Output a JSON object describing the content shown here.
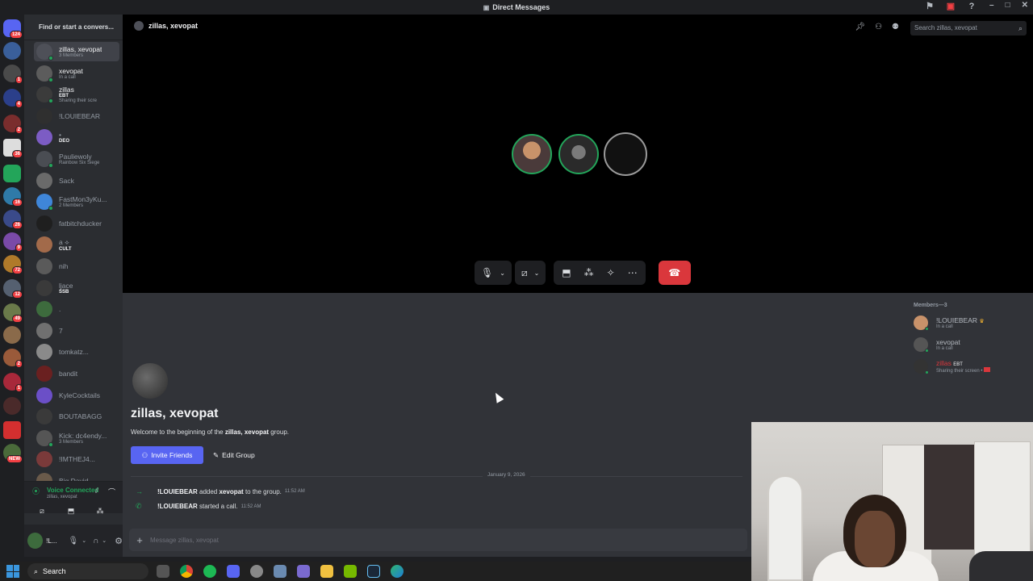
{
  "window": {
    "title": "Direct Messages",
    "controls": [
      "–",
      "□",
      "✕"
    ]
  },
  "dm_sidebar": {
    "find_placeholder": "Find or start a convers...",
    "items": [
      {
        "name": "zillas, xevopat",
        "sub": "3 Members",
        "active": true,
        "color": "#4e5058"
      },
      {
        "name": "xevopat",
        "sub": "In a call",
        "color": "#5c5c5c"
      },
      {
        "name": "zillas",
        "tag": "EBT",
        "sub": "Sharing their scre",
        "color": "#3b3b3b"
      },
      {
        "name": "!LOUIEBEAR",
        "sub": "",
        "color": "#2f2f2f"
      },
      {
        "name": "•",
        "tag": "DEO",
        "sub": "",
        "color": "#7c5cc4"
      },
      {
        "name": "Pauliewoly",
        "sub": "Rainbow Six Siege",
        "color": "#4a4d53"
      },
      {
        "name": "Sack",
        "sub": "",
        "color": "#6a6a6a"
      },
      {
        "name": "FastMon3yKu...",
        "sub": "2 Members",
        "color": "#3f86d9"
      },
      {
        "name": "fatbitchducker",
        "sub": "",
        "color": "#1f1f1f"
      },
      {
        "name": "a ⟡",
        "tag": "CULT",
        "sub": "",
        "color": "#a26a4a"
      },
      {
        "name": "nih",
        "sub": "",
        "color": "#5a5a5a"
      },
      {
        "name": "ljace",
        "tag": "SSB",
        "sub": "",
        "color": "#3a3a3a"
      },
      {
        "name": ".",
        "sub": "",
        "color": "#3d6b3d"
      },
      {
        "name": "7",
        "sub": "",
        "color": "#707070"
      },
      {
        "name": "tomkatz...",
        "sub": "",
        "color": "#8a8a8a"
      },
      {
        "name": "bandit",
        "sub": "",
        "color": "#6a2020"
      },
      {
        "name": "KyleCocktails",
        "sub": "",
        "color": "#6b4fc7"
      },
      {
        "name": "BOUTABAGG",
        "sub": "",
        "color": "#3a3a3a"
      },
      {
        "name": "Kick: dc4endy...",
        "sub": "3 Members",
        "color": "#555555"
      },
      {
        "name": "!IMTHEJ4...",
        "sub": "",
        "color": "#7a3a3a"
      },
      {
        "name": "Big David...",
        "sub": "",
        "color": "#6a5a4a"
      }
    ],
    "voice": {
      "title": "Voice Connected",
      "channel": "zillas, xevopat"
    },
    "user": {
      "name": "!L..."
    }
  },
  "servers": {
    "badges": [
      "124",
      "1",
      "4",
      "2",
      "36",
      "16",
      "26",
      "9",
      "72",
      "12",
      "49",
      "2",
      "1",
      "NEW"
    ]
  },
  "header": {
    "channel": "zillas, xevopat",
    "search_placeholder": "Search zillas, xevopat"
  },
  "welcome": {
    "title": "zillas, xevopat",
    "desc_prefix": "Welcome to the beginning of the ",
    "desc_bold": "zillas, xevopat",
    "desc_suffix": " group.",
    "invite_label": "Invite Friends",
    "edit_label": "Edit Group"
  },
  "messages": {
    "date": "January 9, 2026",
    "items": [
      {
        "icon": "→",
        "who": "!LOUIEBEAR",
        "text": " added ",
        "target": "xevopat",
        "rest": " to the group.",
        "time": "11:52 AM"
      },
      {
        "icon": "✆",
        "who": "!LOUIEBEAR",
        "text": " started a call.",
        "target": "",
        "rest": "",
        "time": "11:52 AM"
      }
    ],
    "input_placeholder": "Message zillas, xevopat"
  },
  "members": {
    "heading": "Members—3",
    "list": [
      {
        "name": "!LOUIEBEAR",
        "sub": "In a call",
        "crown": "♛"
      },
      {
        "name": "xevopat",
        "sub": "In a call"
      },
      {
        "name": "zillas",
        "tag": "EBT",
        "sub": "Sharing their screen •"
      }
    ]
  },
  "taskbar": {
    "search_label": "Search"
  },
  "colors": {
    "accent": "#5865f2",
    "online": "#23a55a",
    "danger": "#da373c"
  }
}
